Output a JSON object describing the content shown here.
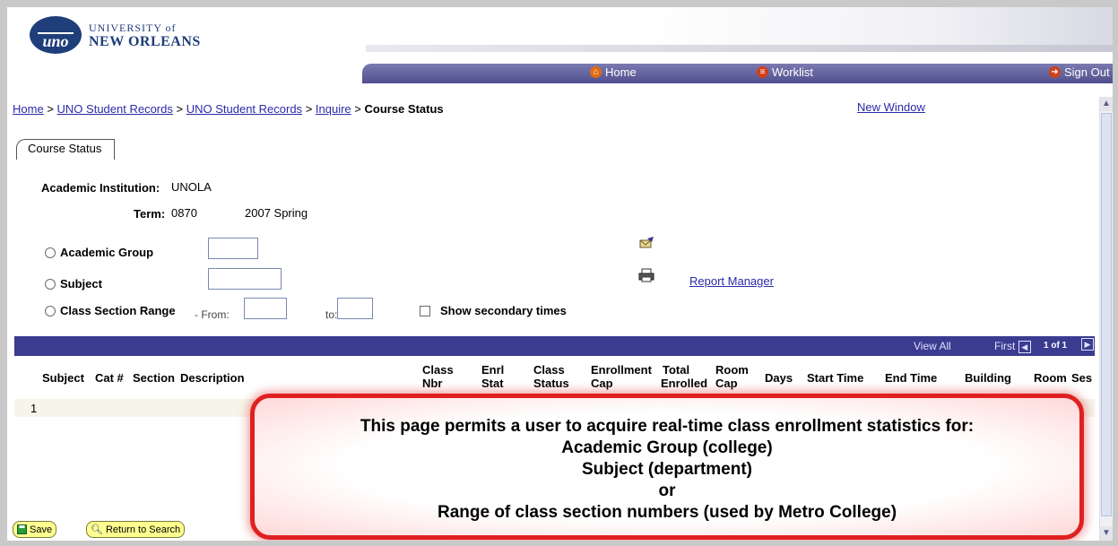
{
  "header": {
    "logo_line1": "UNIVERSITY of",
    "logo_line2": "NEW ORLEANS",
    "logo_seal": "uno",
    "nav": [
      {
        "label": "Home",
        "icon": "home-icon"
      },
      {
        "label": "Worklist",
        "icon": "worklist-icon"
      },
      {
        "label": "Sign Out",
        "icon": "sign-out-icon"
      }
    ]
  },
  "breadcrumb": {
    "items": [
      "Home",
      "UNO Student Records",
      "UNO Student Records",
      "Inquire"
    ],
    "separator": ">",
    "current": "Course Status"
  },
  "new_window": "New Window",
  "tab": {
    "label": "Course Status"
  },
  "form": {
    "institution_label": "Academic Institution:",
    "institution_value": "UNOLA",
    "term_label": "Term:",
    "term_code": "0870",
    "term_desc": "2007 Spring",
    "academic_group_label": "Academic Group",
    "subject_label": "Subject",
    "class_section_label": "Class Section Range",
    "from_label": "- From:",
    "to_label": "to:",
    "show_secondary_label": "Show secondary times",
    "report_manager": "Report Manager"
  },
  "grid": {
    "view_all": "View All",
    "first": "First",
    "page_info": "1 of 1",
    "columns": {
      "subject": "Subject",
      "cat": "Cat #",
      "section": "Section",
      "description": "Description",
      "class_nbr_1": "Class",
      "class_nbr_2": "Nbr",
      "enrl_stat_1": "Enrl",
      "enrl_stat_2": "Stat",
      "class_status_1": "Class",
      "class_status_2": "Status",
      "enroll_cap_1": "Enrollment",
      "enroll_cap_2": "Cap",
      "total_enrolled_1": "Total",
      "total_enrolled_2": "Enrolled",
      "room_cap_1": "Room",
      "room_cap_2": "Cap",
      "days": "Days",
      "start_time": "Start Time",
      "end_time": "End Time",
      "building": "Building",
      "room": "Room",
      "ses": "Ses"
    },
    "rows": [
      {
        "num": "1"
      }
    ]
  },
  "callout": {
    "line1": "This page permits a user to acquire real-time class enrollment statistics for:",
    "line2": "Academic Group (college)",
    "line3": "Subject (department)",
    "line4": "or",
    "line5": "Range of class section numbers (used by Metro College)"
  },
  "buttons": {
    "save": "Save",
    "return_to_search": "Return to Search"
  },
  "colors": {
    "navbar": "#4f4f8e",
    "grid_header": "#3b3b90",
    "link": "#2a2aa8",
    "callout_border": "#e02020",
    "button_bg": "#ffff90"
  }
}
